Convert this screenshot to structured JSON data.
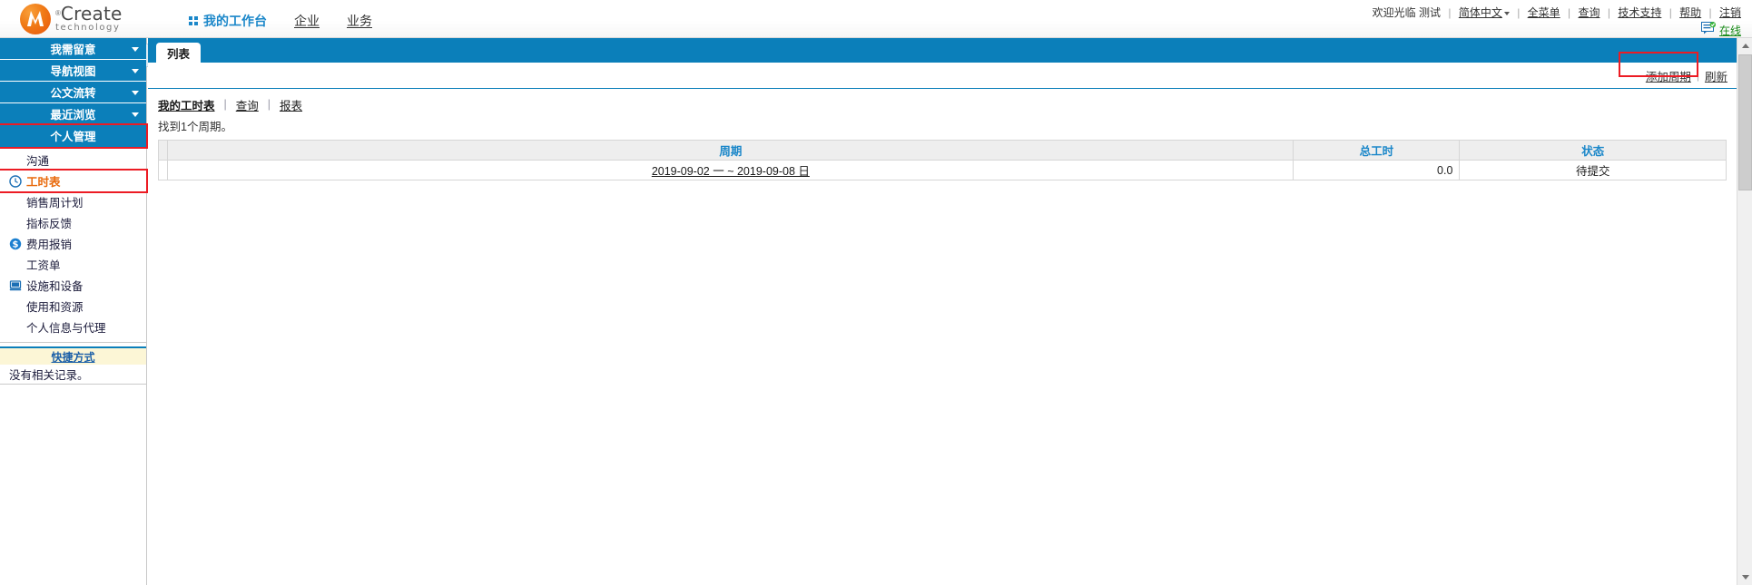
{
  "brand": {
    "name": "Create",
    "registered": "®",
    "tagline": "technology",
    "logo_icon": "create-logo-icon"
  },
  "header": {
    "nav": [
      {
        "label": "我的工作台",
        "active": true,
        "icon": "grid-icon"
      },
      {
        "label": "企业",
        "active": false
      },
      {
        "label": "业务",
        "active": false
      }
    ],
    "welcome": "欢迎光临",
    "user": "测试",
    "language": "简体中文",
    "links": [
      "全菜单",
      "查询",
      "技术支持",
      "帮助",
      "注销"
    ],
    "online_label": "在线",
    "online_icon": "chat-online-icon"
  },
  "sidebar": {
    "groups": [
      {
        "label": "我需留意",
        "icon": "chevron-down-icon",
        "highlighted": false
      },
      {
        "label": "导航视图",
        "icon": "chevron-down-icon",
        "highlighted": false
      },
      {
        "label": "公文流转",
        "icon": "chevron-down-icon",
        "highlighted": false
      },
      {
        "label": "最近浏览",
        "icon": "chevron-down-icon",
        "highlighted": false
      },
      {
        "label": "个人管理",
        "icon": "",
        "highlighted": true
      }
    ],
    "items": [
      {
        "label": "沟通",
        "icon": "",
        "selected": false,
        "highlighted": false
      },
      {
        "label": "工时表",
        "icon": "clock-icon",
        "selected": true,
        "highlighted": true
      },
      {
        "label": "销售周计划",
        "icon": "",
        "selected": false,
        "highlighted": false
      },
      {
        "label": "指标反馈",
        "icon": "",
        "selected": false,
        "highlighted": false
      },
      {
        "label": "费用报销",
        "icon": "dollar-icon",
        "selected": false,
        "highlighted": false
      },
      {
        "label": "工资单",
        "icon": "",
        "selected": false,
        "highlighted": false
      },
      {
        "label": "设施和设备",
        "icon": "computer-icon",
        "selected": false,
        "highlighted": false
      },
      {
        "label": "使用和资源",
        "icon": "",
        "selected": false,
        "highlighted": false
      },
      {
        "label": "个人信息与代理",
        "icon": "",
        "selected": false,
        "highlighted": false
      }
    ],
    "shortcuts": {
      "title": "快捷方式",
      "empty": "没有相关记录。"
    },
    "collapse_icon": "collapse-handle-icon"
  },
  "main": {
    "tab": "列表",
    "actions": {
      "add_period": "添加周期",
      "refresh": "刷新"
    },
    "subnav": [
      {
        "label": "我的工时表",
        "current": true
      },
      {
        "label": "查询",
        "current": false
      },
      {
        "label": "报表",
        "current": false
      }
    ],
    "result_text": "找到1个周期。",
    "table": {
      "columns": [
        "",
        "周期",
        "总工时",
        "状态"
      ],
      "rows": [
        {
          "period": "2019-09-02 一 ~ 2019-09-08 日",
          "hours": "0.0",
          "status": "待提交"
        }
      ]
    }
  },
  "colors": {
    "brand_blue": "#0b7fba",
    "link_blue": "#1b87c9",
    "highlight_red": "#ec1c24",
    "selected_orange": "#e8690b",
    "online_green": "#188a18"
  }
}
